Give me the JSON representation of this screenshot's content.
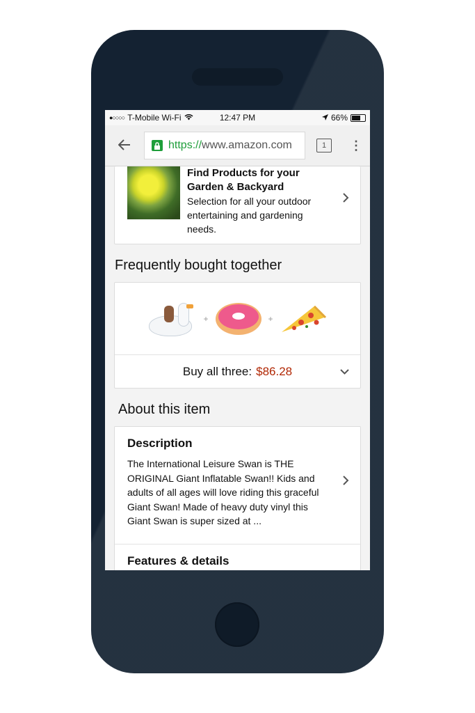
{
  "status_bar": {
    "carrier": "T-Mobile Wi-Fi",
    "time": "12:47 PM",
    "battery": "66%",
    "battery_level": 0.66
  },
  "browser": {
    "url_scheme": "https://",
    "url_host": "www.amazon.com",
    "tab_count": "1"
  },
  "garden_promo": {
    "title_line1": "Find Products for your",
    "title_line2": "Garden & Backyard",
    "text": "Selection for all your outdoor entertaining and gardening needs."
  },
  "frequently_bought": {
    "heading": "Frequently bought together",
    "buy_all_label": "Buy all three:",
    "buy_all_price": "$86.28",
    "price_color": "#b12704"
  },
  "about": {
    "heading": "About this item",
    "description_title": "Description",
    "description_text": "The International Leisure Swan is THE ORIGINAL Giant Inflatable Swan!! Kids and adults of all ages will love riding this graceful Giant Swan! Made of heavy duty vinyl this Giant Swan is super sized at ...",
    "features_title": "Features & details"
  },
  "icons": {
    "back": "arrow-left-icon",
    "lock": "lock-icon",
    "menu": "more-vert-icon",
    "chevron": "chevron-right-icon",
    "expand": "chevron-down-icon"
  }
}
